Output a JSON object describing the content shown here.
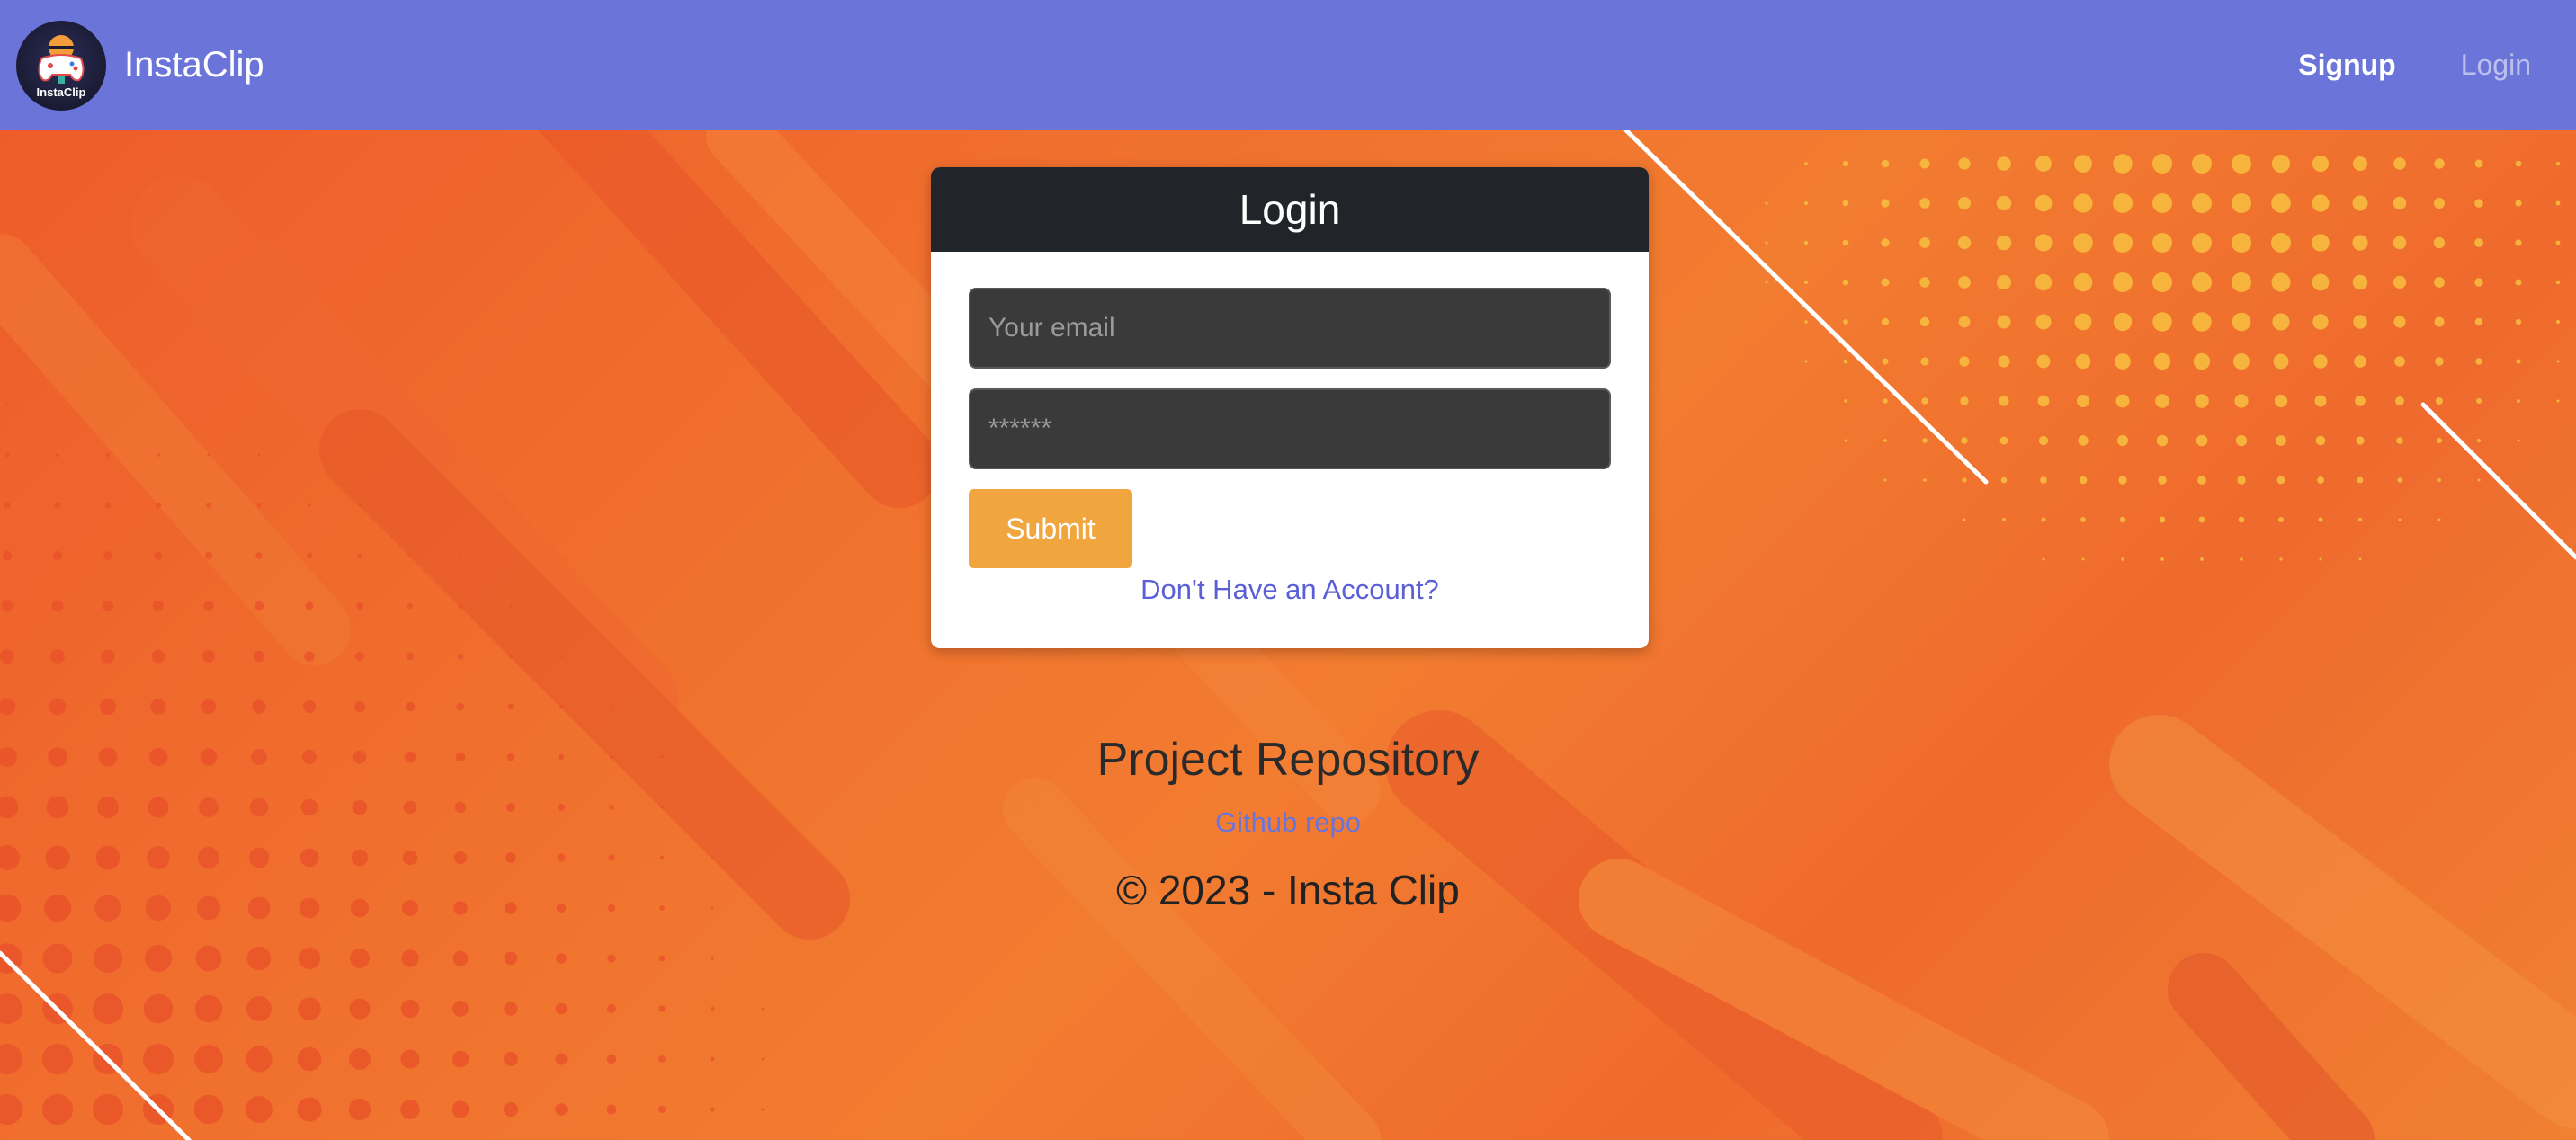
{
  "navbar": {
    "brand_name": "InstaClip",
    "logo_text": "InstaClip",
    "links": [
      {
        "label": "Signup",
        "active": true
      },
      {
        "label": "Login",
        "active": false
      }
    ],
    "background_color": "#6b74d9"
  },
  "login_card": {
    "title": "Login",
    "email_placeholder": "Your email",
    "password_placeholder": "******",
    "submit_label": "Submit",
    "signup_prompt": "Don't Have an Account?"
  },
  "footer": {
    "title": "Project Repository",
    "repo_link": "Github repo",
    "copyright": "© 2023 - Insta Clip"
  },
  "colors": {
    "header_dark": "#212529",
    "submit": "#f0a53e",
    "link": "#5a5fd8",
    "background": "#f26a2c"
  },
  "icons": [
    "gamepad-logo-icon"
  ]
}
